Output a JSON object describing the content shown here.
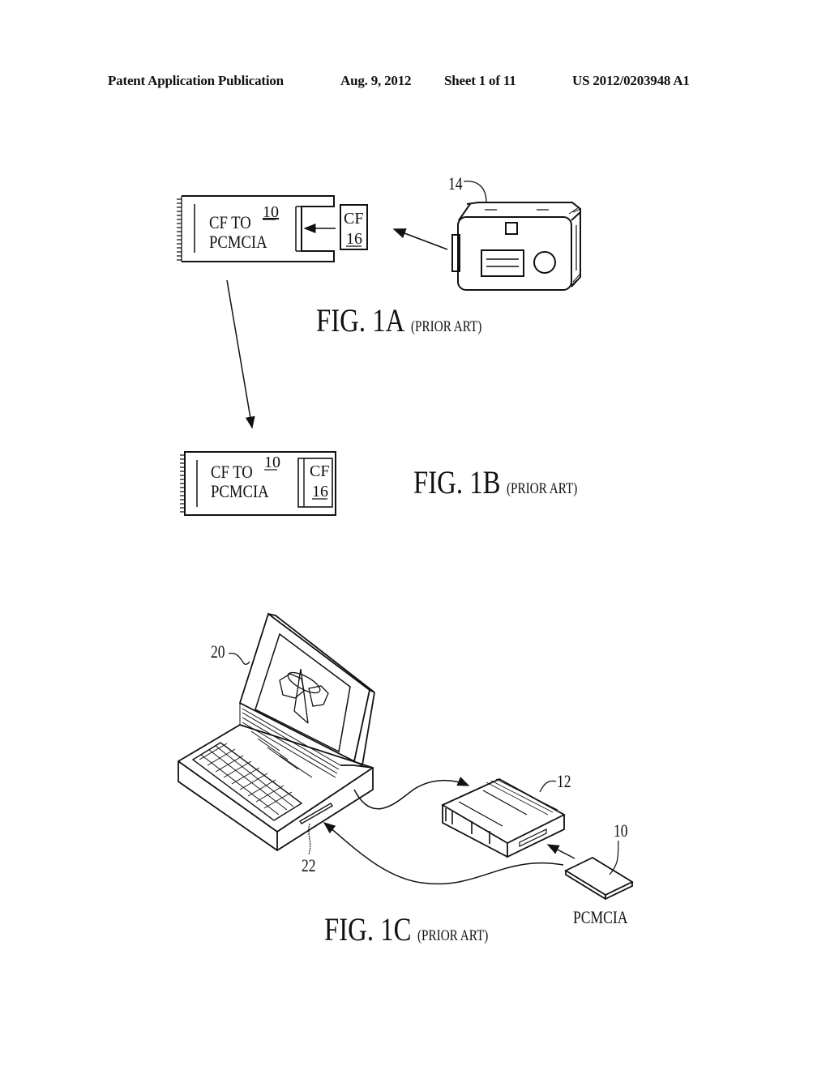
{
  "header": {
    "publication_type": "Patent Application Publication",
    "date": "Aug. 9, 2012",
    "sheet": "Sheet 1 of 11",
    "pub_number": "US 2012/0203948 A1"
  },
  "figures": {
    "fig1a": {
      "title": "FIG. 1A",
      "note": "(PRIOR ART)",
      "adapter_line1": "CF TO",
      "adapter_line2": "PCMCIA",
      "adapter_ref": "10",
      "cf_card_label": "CF",
      "cf_card_ref": "16",
      "camera_ref": "14"
    },
    "fig1b": {
      "title": "FIG. 1B",
      "note": "(PRIOR ART)",
      "adapter_line1": "CF TO",
      "adapter_line2": "PCMCIA",
      "adapter_ref": "10",
      "cf_card_label": "CF",
      "cf_card_ref": "16"
    },
    "fig1c": {
      "title": "FIG. 1C",
      "note": "(PRIOR ART)",
      "laptop_ref": "20",
      "slot_ref": "22",
      "reader_ref": "12",
      "card_ref": "10",
      "card_label": "PCMCIA"
    }
  }
}
